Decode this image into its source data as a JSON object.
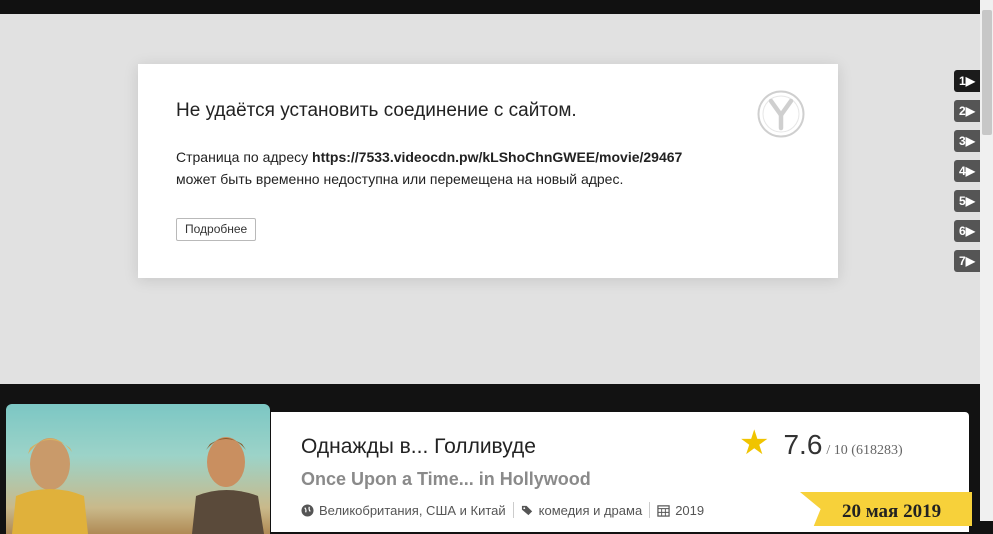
{
  "error": {
    "title": "Не удаётся установить соединение с сайтом.",
    "line1_prefix": "Страница по адресу ",
    "url": "https://7533.videocdn.pw/kLShoChnGWEE/movie/29467",
    "line2": "может быть временно недоступна или перемещена на новый адрес.",
    "more_button": "Подробнее",
    "logo_icon": "yandex-browser-icon"
  },
  "servers": [
    {
      "label": "1▶",
      "active": true
    },
    {
      "label": "2▶",
      "active": false
    },
    {
      "label": "3▶",
      "active": false
    },
    {
      "label": "4▶",
      "active": false
    },
    {
      "label": "5▶",
      "active": false
    },
    {
      "label": "6▶",
      "active": false
    },
    {
      "label": "7▶",
      "active": false
    }
  ],
  "movie": {
    "title": "Однажды в... Голливуде",
    "original_title": "Once Upon a Time... in Hollywood",
    "countries": "Великобритания, США и Китай",
    "genres": "комедия и драма",
    "year": "2019",
    "rating": "7.6",
    "rating_rest": "/ 10 (618283)",
    "release_date": "20 мая 2019"
  },
  "colors": {
    "star": "#f0c400",
    "ribbon": "#f7d13a",
    "active_server": "#1b1b1b",
    "server": "#555555"
  }
}
